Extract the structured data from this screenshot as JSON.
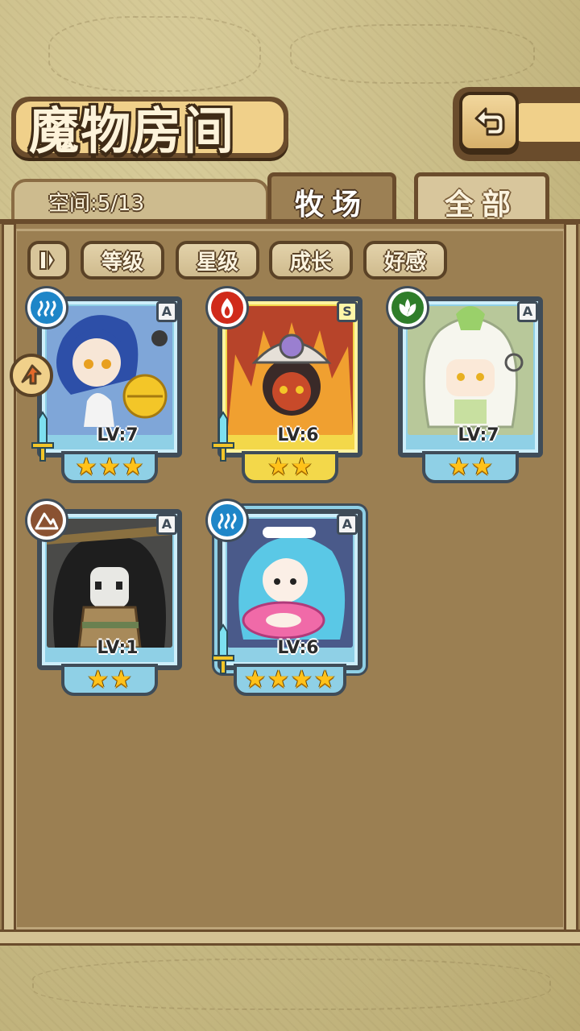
{
  "header": {
    "title": "魔物房间",
    "back_icon": "return-arrow-icon"
  },
  "tabs": {
    "space_text": "空间:5/13",
    "active": "牧场",
    "inactive": "全部"
  },
  "sort": {
    "toggle_icon": "sort-order-icon",
    "buttons": [
      "等级",
      "星级",
      "成长",
      "好感"
    ]
  },
  "monsters": [
    {
      "element": "water",
      "element_color": "#1e86c8",
      "rarity": "A",
      "level": "LV:7",
      "stars": 3,
      "frame": "blue",
      "equipped_weapon": true,
      "favorite": true
    },
    {
      "element": "fire",
      "element_color": "#d02a1a",
      "rarity": "S",
      "level": "LV:6",
      "stars": 2,
      "frame": "gold",
      "equipped_weapon": true,
      "favorite": false
    },
    {
      "element": "grass",
      "element_color": "#2f7d2a",
      "rarity": "A",
      "level": "LV:7",
      "stars": 2,
      "frame": "blue",
      "equipped_weapon": false,
      "favorite": false
    },
    {
      "element": "earth",
      "element_color": "#8a5232",
      "rarity": "A",
      "level": "LV:1",
      "stars": 2,
      "frame": "blue",
      "equipped_weapon": false,
      "favorite": false
    },
    {
      "element": "water",
      "element_color": "#1e86c8",
      "rarity": "A",
      "level": "LV:6",
      "stars": 4,
      "frame": "blue",
      "equipped_weapon": true,
      "favorite": false
    }
  ]
}
